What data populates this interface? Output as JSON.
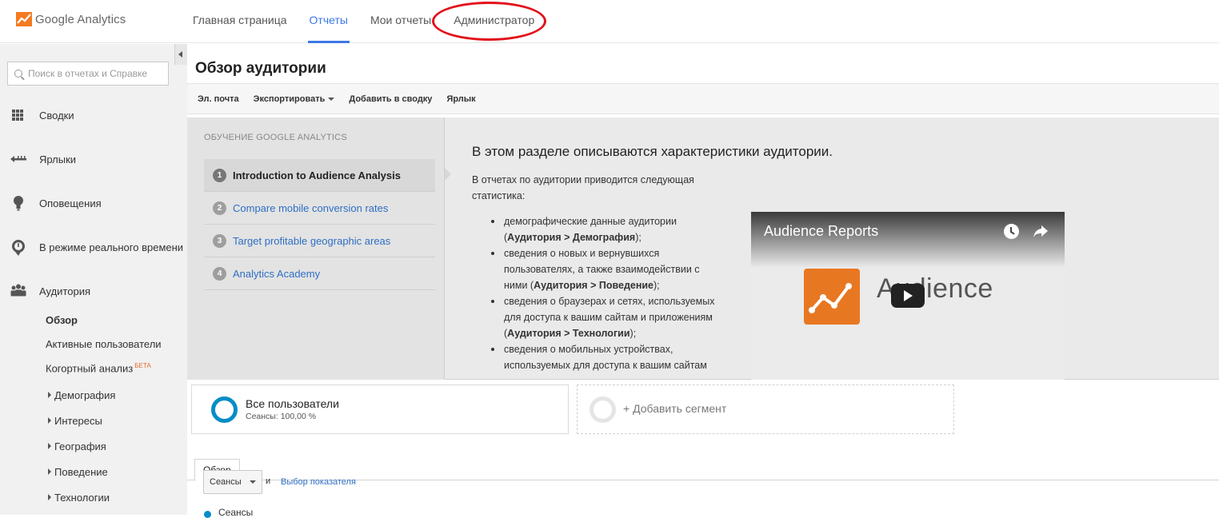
{
  "app": {
    "brand": "Google Analytics"
  },
  "nav": {
    "items": [
      "Главная страница",
      "Отчеты",
      "Мои отчеты",
      "Администратор"
    ],
    "active": "Отчеты"
  },
  "sidebar": {
    "search_placeholder": "Поиск в отчетах и Справке",
    "items": [
      "Сводки",
      "Ярлыки",
      "Оповещения",
      "В режиме реального времени",
      "Аудитория"
    ],
    "audience_sub": [
      "Обзор",
      "Активные пользователи",
      "Когортный анализ"
    ],
    "beta_label": "БЕТА",
    "audience_tree": [
      "Демография",
      "Интересы",
      "География",
      "Поведение",
      "Технологии"
    ]
  },
  "page": {
    "title": "Обзор аудитории"
  },
  "toolbar": {
    "email": "Эл. почта",
    "export": "Экспортировать",
    "add_to_dashboard": "Добавить в сводку",
    "shortcut": "Ярлык"
  },
  "learning": {
    "heading": "ОБУЧЕНИЕ GOOGLE ANALYTICS",
    "steps": [
      {
        "num": "1",
        "label": "Introduction to Audience Analysis"
      },
      {
        "num": "2",
        "label": "Compare mobile conversion rates"
      },
      {
        "num": "3",
        "label": "Target profitable geographic areas"
      },
      {
        "num": "4",
        "label": "Analytics Academy"
      }
    ],
    "title": "В этом разделе описываются характеристики аудитории.",
    "intro": "В отчетах по аудитории приводится следующая статистика:",
    "bullets": [
      {
        "text": "демографические данные аудитории (",
        "bold": "Аудитория > Демография",
        "tail": ");"
      },
      {
        "text": "сведения о новых и вернувшихся пользователях, а также взаимодействии с ними (",
        "bold": "Аудитория > Поведение",
        "tail": ");"
      },
      {
        "text": "сведения о браузерах и сетях, используемых для доступа к вашим сайтам и приложениям (",
        "bold": "Аудитория > Технологии",
        "tail": ");"
      },
      {
        "text": "сведения о мобильных устройствах, используемых для доступа к вашим сайтам",
        "bold": "",
        "tail": ""
      }
    ]
  },
  "video": {
    "title": "Audience Reports",
    "word": "Audience"
  },
  "segments": {
    "all_users": "Все пользователи",
    "all_users_sub": "Сеансы: 100,00 %",
    "add_segment": "+ Добавить сегмент"
  },
  "tabs": {
    "overview": "Обзор"
  },
  "metrics": {
    "selected": "Сеансы",
    "and": "и",
    "choose_metric": "Выбор показателя",
    "legend": "Сеансы"
  },
  "colors": {
    "accent": "#3b78e7",
    "segment": "#058dc7",
    "annotation": "#e2101a",
    "brand": "#e87722"
  }
}
